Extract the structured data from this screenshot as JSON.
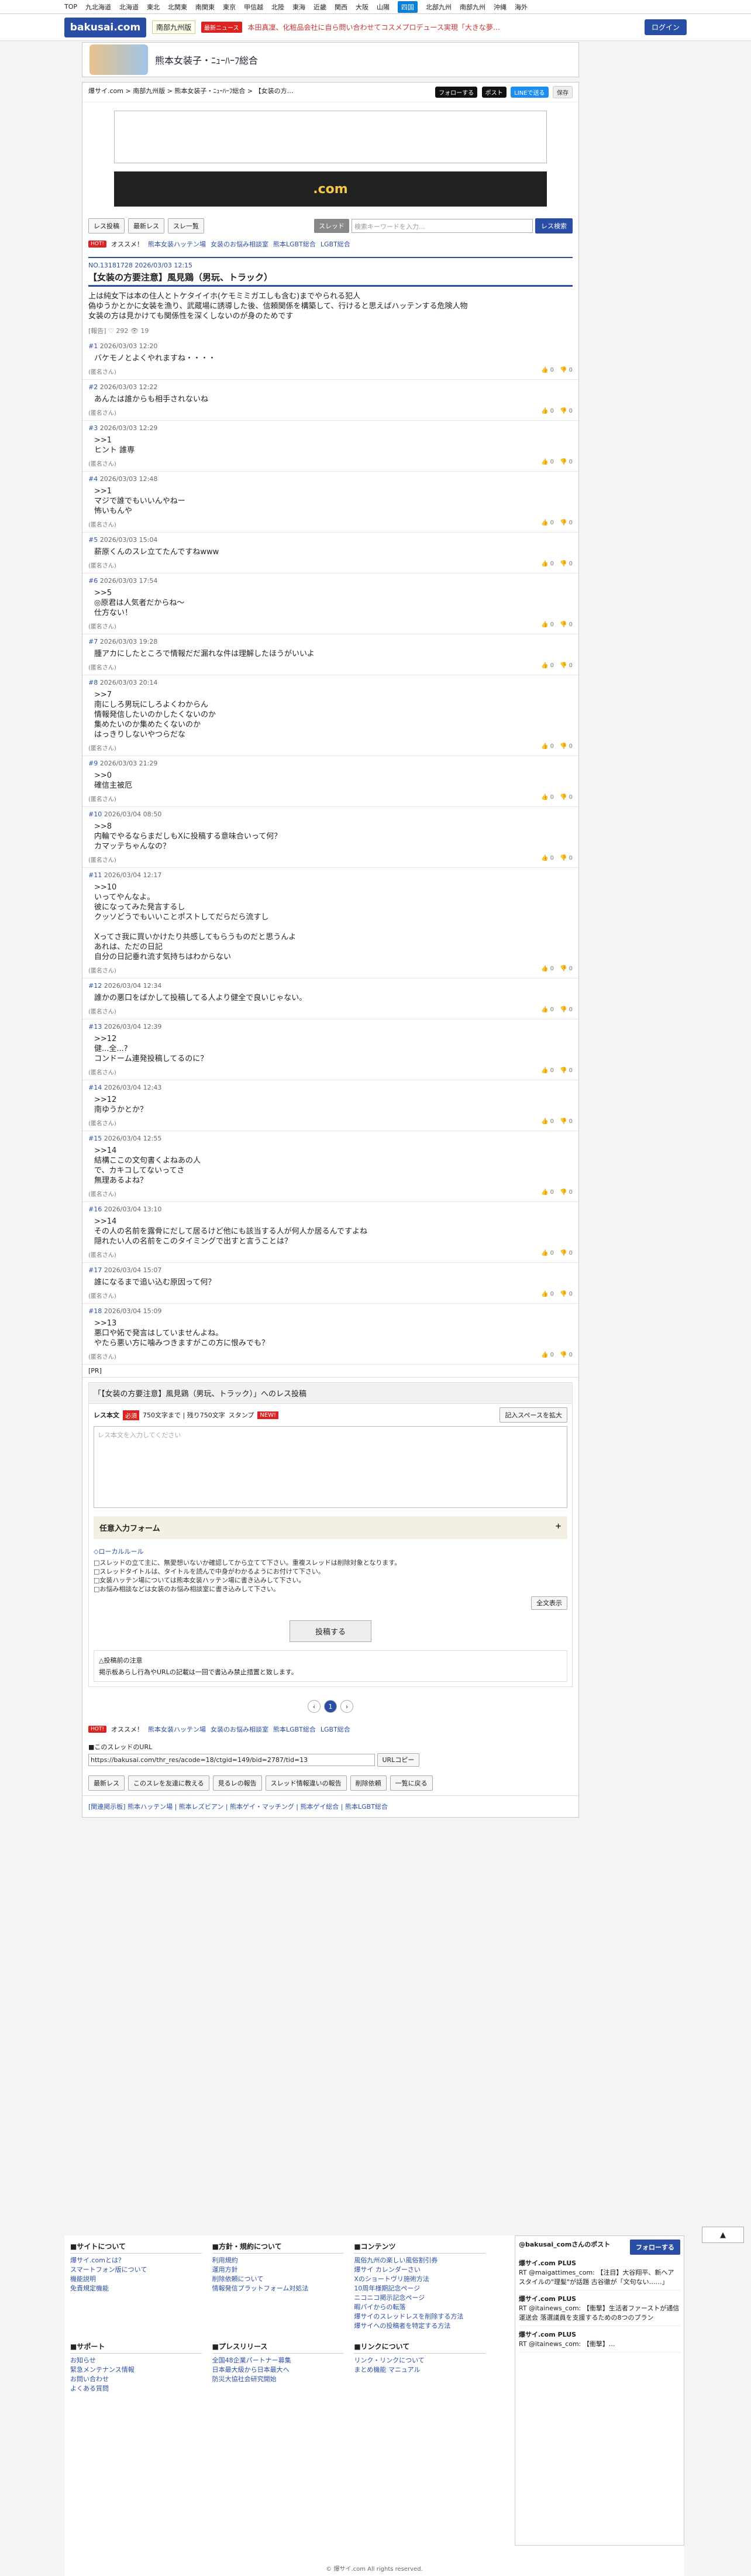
{
  "topnav": [
    "TOP",
    "九北海道",
    "北海道",
    "東北",
    "北関東",
    "南関東",
    "東京",
    "甲信越",
    "北陸",
    "東海",
    "近畿",
    "関西",
    "大阪",
    "山陽",
    "四国",
    "北部九州",
    "南部九州",
    "沖縄",
    "海外"
  ],
  "site": {
    "logo": "bakusai.com",
    "region": "南部九州版",
    "news_badge": "最新ニュース",
    "news": "本田真凜、化粧品会社に自ら問い合わせてコスメプロデュース実現「大きな夢…",
    "login": "ログイン",
    "board": "熊本女装子・ﾆｭｰﾊｰﾌ総合"
  },
  "crumb": "爆サイ.com > 南部九州版 > 熊本女装子・ﾆｭｰﾊｰﾌ総合 > 【女装の方…",
  "share": {
    "follow": "フォローする",
    "post": "ポスト",
    "line": "LINEで送る",
    "save": "保存"
  },
  "toolbar": {
    "res_post": "レス投稿",
    "latest": "最新レス",
    "thread_list": "スレ一覧",
    "select": "スレッド",
    "search_placeholder": "検索キーワードを入力...",
    "search_btn": "レス検索"
  },
  "hot": {
    "label": "HOT!",
    "text": "オススメ！",
    "links": [
      "熊本女装ハッテン場",
      "女装のお悩み相談室",
      "熊本LGBT総合",
      "LGBT総合"
    ]
  },
  "thread": {
    "meta": "NO.13181728 2026/03/03 12:15",
    "title": "【女装の方要注意】風見鶏（男玩、トラック）",
    "body": "上は純女下は本の住人とトケタイイホ(ケモミミガエしも含む)までやられる犯人\n偽ゆうかとかに女装を漁り、武蔵場に誘導した後、信頼関係を構築して、行けると思えばハッテンする危険人物\n女装の方は見かけても関係性を深くしないのが身のためです",
    "stats": "[報告] ♡ 292 👁 19"
  },
  "posts": [
    {
      "no": "#1",
      "date": "2026/03/03 12:20",
      "body": "バケモノとよくやれますね・・・・",
      "name": "(匿名さん)"
    },
    {
      "no": "#2",
      "date": "2026/03/03 12:22",
      "body": "あんたは誰からも相手されないね",
      "name": "(匿名さん)"
    },
    {
      "no": "#3",
      "date": "2026/03/03 12:29",
      "body": ">>1\nヒント 誰専",
      "name": "(匿名さん)"
    },
    {
      "no": "#4",
      "date": "2026/03/03 12:48",
      "body": ">>1\nマジで誰でもいいんやねー\n怖いもんや",
      "name": "(匿名さん)"
    },
    {
      "no": "#5",
      "date": "2026/03/03 15:04",
      "body": "薪原くんのスレ立てたんですねwww",
      "name": "(匿名さん)"
    },
    {
      "no": "#6",
      "date": "2026/03/03 17:54",
      "body": ">>5\n◎原君は人気者だからね〜\n仕方ない！",
      "name": "(匿名さん)"
    },
    {
      "no": "#7",
      "date": "2026/03/03 19:28",
      "body": "腫アカにしたところで情報だだ漏れな件は理解したほうがいいよ",
      "name": "(匿名さん)"
    },
    {
      "no": "#8",
      "date": "2026/03/03 20:14",
      "body": ">>7\n南にしろ男玩にしろよくわからん\n情報発信したいのかしたくないのか\n集めたいのか集めたくないのか\nはっきりしないやつらだな",
      "name": "(匿名さん)"
    },
    {
      "no": "#9",
      "date": "2026/03/03 21:29",
      "body": ">>0\n確信主被厄",
      "name": "(匿名さん)"
    },
    {
      "no": "#10",
      "date": "2026/03/04 08:50",
      "body": ">>8\n内輪でやるならまだしもXに投稿する意味合いって何？\nカマッテちゃんなの？",
      "name": "(匿名さん)"
    },
    {
      "no": "#11",
      "date": "2026/03/04 12:17",
      "body": ">>10\nいってやんなよ。\n彼になってみた発言するし\nクッソどうでもいいことポストしてだらだら流すし\n\nXってさ我に買いかけたり共感してもらうものだと思うんよ\nあれは、ただの日記\n自分の日記垂れ流す気持ちはわからない",
      "name": "(匿名さん)"
    },
    {
      "no": "#12",
      "date": "2026/03/04 12:34",
      "body": "誰かの悪口をばかして投稿してる人より健全で良いじゃない。",
      "name": "(匿名さん)"
    },
    {
      "no": "#13",
      "date": "2026/03/04 12:39",
      "body": ">>12\n健...全...?\nコンドーム連発投稿してるのに？",
      "name": "(匿名さん)"
    },
    {
      "no": "#14",
      "date": "2026/03/04 12:43",
      "body": ">>12\n南ゆうかとか？",
      "name": "(匿名さん)"
    },
    {
      "no": "#15",
      "date": "2026/03/04 12:55",
      "body": ">>14\n結構ここの文句書くよねあの人\nで、カキコしてないってさ\n無理あるよね？",
      "name": "(匿名さん)"
    },
    {
      "no": "#16",
      "date": "2026/03/04 13:10",
      "body": ">>14\nその人の名前を露骨にだして居るけど他にも該当する人が何人か居るんですよね\n隠れたい人の名前をこのタイミングで出すと言うことは？",
      "name": "(匿名さん)"
    },
    {
      "no": "#17",
      "date": "2026/03/04 15:07",
      "body": "誰になるまで追い込む原因って何？",
      "name": "(匿名さん)"
    },
    {
      "no": "#18",
      "date": "2026/03/04 15:09",
      "body": ">>13\n悪口や妬で発言はしていませんよね。\nやたら悪い方に噛みつきますがこの方に恨みでも？",
      "name": "(匿名さん)"
    }
  ],
  "votes": {
    "up": "0",
    "down": "0"
  },
  "pr": "[PR]",
  "form": {
    "title": "「【女装の方要注意】風見鶏（男玩、トラック）」へのレス投稿",
    "res_no": "レス本文",
    "required": "必須",
    "chars": "750文字まで | 残り750文字",
    "stamp": "スタンプ",
    "new": "NEW!",
    "edit": "記入スペースを拡大",
    "placeholder": "レス本文を入力してください",
    "optional": "任意入力フォーム",
    "rules_title": "◇ローカルルール",
    "rules": "□スレッドの立て主に、無愛想いないか確認してから立てて下さい。重複スレッドは削除対象となります。\n□スレッドタイトルは、タイトルを読んで中身がわかるようにお付けて下さい。\n□女装ハッテン場については熊本女装ハッテン場に書き込みして下さい。\n□お悩み相談などは女装のお悩み相談室に書き込みして下さい。",
    "expand": "全文表示",
    "submit": "投稿する",
    "notice_title": "△投稿前の注意",
    "notice": "掲示板あらし行為やURLの記載は一回で書込み禁止措置と致します。"
  },
  "pager": {
    "current": "1"
  },
  "url": {
    "label": "■このスレッドのURL",
    "value": "https://bakusai.com/thr_res/acode=18/ctgid=149/bid=2787/tid=13",
    "copy": "URLコピー"
  },
  "bottom_btns": [
    "最新レス",
    "このスレを友達に教える",
    "見るレの報告",
    "スレッド情報違いの報告",
    "削除依頼",
    "一覧に戻る"
  ],
  "related": "[関連掲示板]  熊本ハッテン場 | 熊本レズビアン | 熊本ゲイ・マッチング | 熊本ゲイ総合 | 熊本LGBT総合",
  "footer": {
    "cols": [
      {
        "title": "■サイトについて",
        "items": [
          "爆サイ.comとは？",
          "スマートフォン版について",
          "機能説明",
          "免責規定機能"
        ]
      },
      {
        "title": "■方針・規約について",
        "items": [
          "利用規約",
          "運用方針",
          "削除依頼について",
          "情報発信プラットフォーム対処法"
        ]
      },
      {
        "title": "■コンテンツ",
        "items": [
          "風俗九州の楽しい風俗割引券",
          "爆サイ カレンダーさい",
          "Xのショートヴリ施術方法",
          "10周年様期記念ページ",
          "ニコニコ掲示記念ページ",
          "暇パイからの転落",
          "爆サイのスレッドレスを削除する方法",
          "爆サイへの投稿者を特定する方法"
        ]
      },
      {
        "title": "■サポート",
        "items": [
          "お知らせ",
          "緊急メンテナンス情報",
          "お問い合わせ",
          "よくある質問"
        ]
      },
      {
        "title": "■プレスリリース",
        "items": [
          "全国48企業パートナー募集",
          "日本最大級から日本最大へ",
          "防災大協社会研究開始"
        ]
      },
      {
        "title": "■リンクについて",
        "items": [
          "リンク・リンクについて",
          "まとめ機能 マニュアル"
        ]
      }
    ],
    "x_title": "@bakusai_comさんのポスト",
    "x_follow": "フォローする",
    "x_posts": [
      {
        "name": "爆サイ.com PLUS",
        "text": "RT @maigattimes_com: 【注目】大谷翔平、新ヘアスタイルの\"理髪\"が話題 古谷徹が「文句ない……」"
      },
      {
        "name": "爆サイ.com PLUS",
        "text": "RT @itainews_com: 【衝撃】生活者ファーストが通信運送会 落選議員を支援するための8つのプラン"
      },
      {
        "name": "爆サイ.com PLUS",
        "text": "RT @itainews_com: 【衝撃】..."
      }
    ],
    "copyright": "© 爆サイ.com All rights reserved."
  }
}
